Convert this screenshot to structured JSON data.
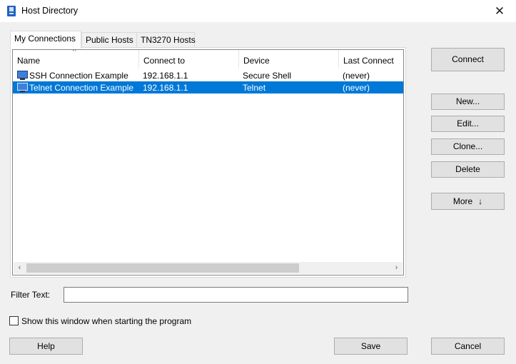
{
  "window": {
    "title": "Host Directory",
    "close_glyph": "✕"
  },
  "tabs": [
    {
      "label": "My Connections",
      "active": true
    },
    {
      "label": "Public Hosts",
      "active": false
    },
    {
      "label": "TN3270 Hosts",
      "active": false
    }
  ],
  "table": {
    "columns": [
      "Name",
      "Connect to",
      "Device",
      "Last Connect"
    ],
    "sort_indicator": "^",
    "rows": [
      {
        "name": "SSH Connection Example",
        "connect_to": "192.168.1.1",
        "device": "Secure Shell",
        "last_connect": "(never)",
        "icon": "monitor-icon",
        "selected": false
      },
      {
        "name": "Telnet Connection Example",
        "connect_to": "192.168.1.1",
        "device": "Telnet",
        "last_connect": "(never)",
        "icon": "monitor-icon",
        "selected": true
      }
    ]
  },
  "scrollbar": {
    "left_arrow": "‹",
    "right_arrow": "›"
  },
  "filter": {
    "label": "Filter Text:",
    "value": ""
  },
  "startup_checkbox": {
    "label": "Show this window when starting the program",
    "checked": false
  },
  "buttons": {
    "connect": "Connect",
    "new": "New...",
    "edit": "Edit...",
    "clone": "Clone...",
    "delete": "Delete",
    "more": "More",
    "more_arrow": "↓",
    "help": "Help",
    "save": "Save",
    "cancel": "Cancel"
  },
  "colors": {
    "selection": "#0078d7",
    "window_bg": "#f0f0f0",
    "button_bg": "#e1e1e1"
  }
}
